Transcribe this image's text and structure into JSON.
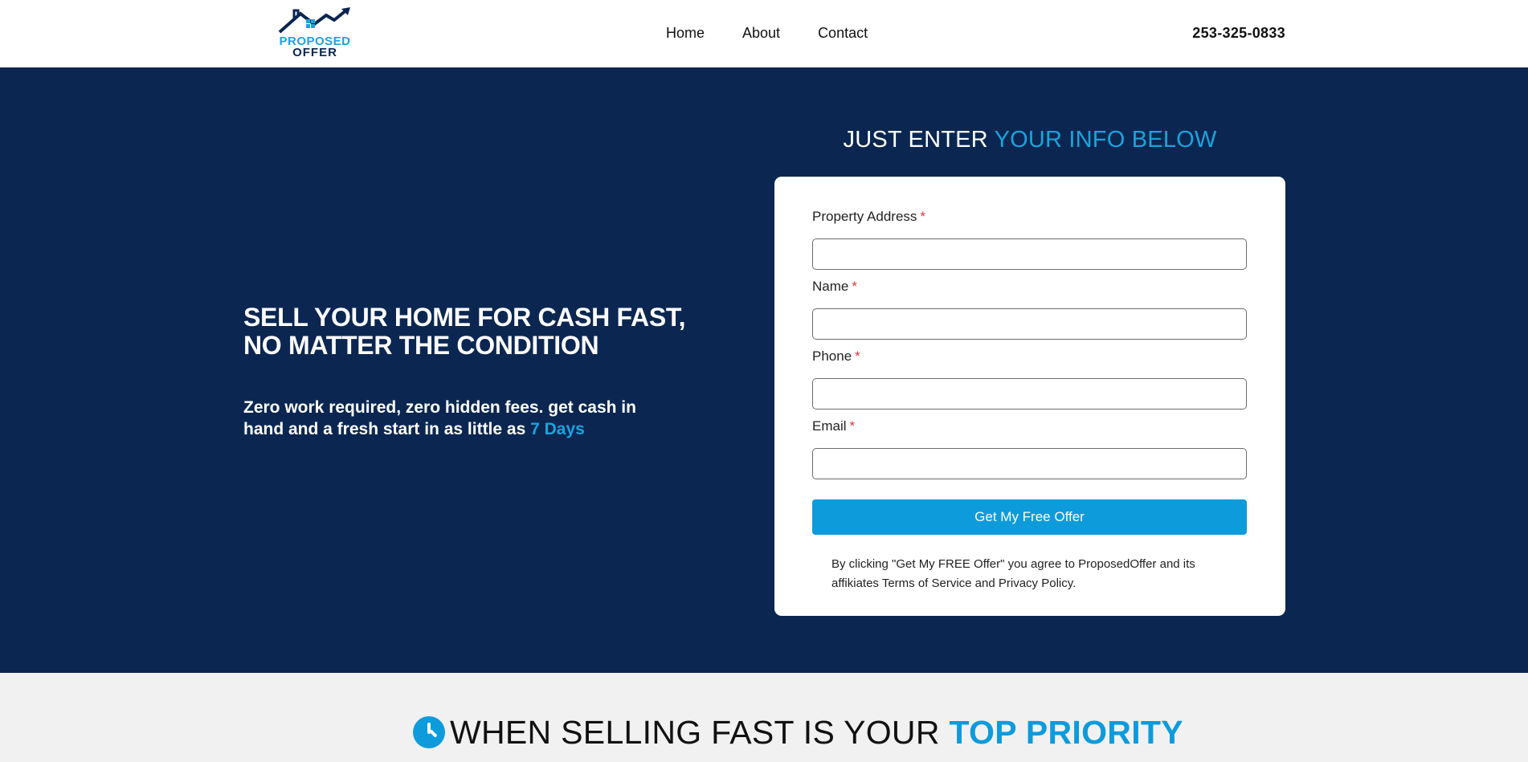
{
  "header": {
    "logo": {
      "line1": "PROPOSED",
      "line2": "OFFER"
    },
    "nav": [
      "Home",
      "About",
      "Contact"
    ],
    "phone": "253-325-0833"
  },
  "hero": {
    "title_line1": "SELL YOUR HOME FOR CASH FAST,",
    "title_line2": "NO MATTER THE CONDITION",
    "subtitle": "Zero work required, zero hidden fees. get cash in hand and a fresh start in as little as",
    "subtitle_accent": "7 Days"
  },
  "form": {
    "heading": "JUST ENTER",
    "heading_accent": "YOUR INFO BELOW",
    "fields": [
      {
        "label": "Property Address",
        "value": ""
      },
      {
        "label": "Name",
        "value": ""
      },
      {
        "label": "Phone",
        "value": ""
      },
      {
        "label": "Email",
        "value": ""
      }
    ],
    "required_mark": "*",
    "submit_label": "Get My Free Offer",
    "disclaimer": "By clicking \"Get My FREE Offer\" you agree to ProposedOffer and its affikiates Terms of Service and Privacy Policy."
  },
  "section2": {
    "heading": "WHEN SELLING FAST IS YOUR",
    "heading_accent": "TOP PRIORITY"
  },
  "colors": {
    "navy": "#0b2751",
    "accent_blue": "#0d9bdc",
    "required_red": "#e0343c",
    "light_gray": "#f1f1f1"
  }
}
